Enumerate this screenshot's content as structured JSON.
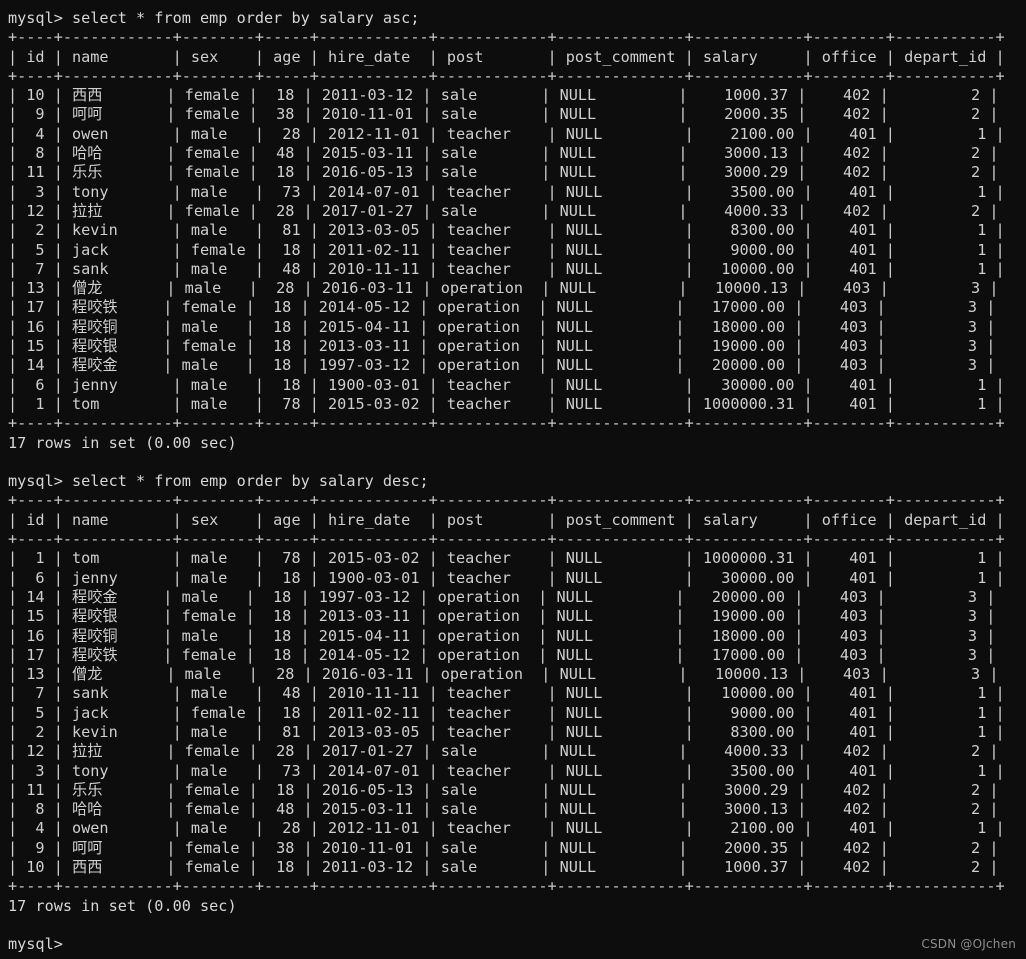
{
  "terminal": {
    "prompt": "mysql> ",
    "colors": {
      "background": "#0d0d0d",
      "foreground": "#cfcfcf",
      "watermark": "#8d8d8d"
    },
    "watermark": "CSDN @OJchen",
    "trailing_prompt": "mysql>"
  },
  "table_schema": {
    "columns": [
      {
        "name": "id",
        "width": 2,
        "align": "right"
      },
      {
        "name": "name",
        "width": 10,
        "align": "left"
      },
      {
        "name": "sex",
        "width": 6,
        "align": "left"
      },
      {
        "name": "age",
        "width": 3,
        "align": "right"
      },
      {
        "name": "hire_date",
        "width": 10,
        "align": "left"
      },
      {
        "name": "post",
        "width": 10,
        "align": "left"
      },
      {
        "name": "post_comment",
        "width": 12,
        "align": "left"
      },
      {
        "name": "salary",
        "width": 10,
        "align": "right"
      },
      {
        "name": "office",
        "width": 6,
        "align": "right"
      },
      {
        "name": "depart_id",
        "width": 9,
        "align": "right"
      }
    ]
  },
  "blocks": [
    {
      "command": "select * from emp order by salary asc;",
      "status": "17 rows in set (0.00 sec)",
      "rows": [
        [
          "10",
          "西西",
          "female",
          "18",
          "2011-03-12",
          "sale",
          "NULL",
          "1000.37",
          "402",
          "2"
        ],
        [
          "9",
          "呵呵",
          "female",
          "38",
          "2010-11-01",
          "sale",
          "NULL",
          "2000.35",
          "402",
          "2"
        ],
        [
          "4",
          "owen",
          "male",
          "28",
          "2012-11-01",
          "teacher",
          "NULL",
          "2100.00",
          "401",
          "1"
        ],
        [
          "8",
          "哈哈",
          "female",
          "48",
          "2015-03-11",
          "sale",
          "NULL",
          "3000.13",
          "402",
          "2"
        ],
        [
          "11",
          "乐乐",
          "female",
          "18",
          "2016-05-13",
          "sale",
          "NULL",
          "3000.29",
          "402",
          "2"
        ],
        [
          "3",
          "tony",
          "male",
          "73",
          "2014-07-01",
          "teacher",
          "NULL",
          "3500.00",
          "401",
          "1"
        ],
        [
          "12",
          "拉拉",
          "female",
          "28",
          "2017-01-27",
          "sale",
          "NULL",
          "4000.33",
          "402",
          "2"
        ],
        [
          "2",
          "kevin",
          "male",
          "81",
          "2013-03-05",
          "teacher",
          "NULL",
          "8300.00",
          "401",
          "1"
        ],
        [
          "5",
          "jack",
          "female",
          "18",
          "2011-02-11",
          "teacher",
          "NULL",
          "9000.00",
          "401",
          "1"
        ],
        [
          "7",
          "sank",
          "male",
          "48",
          "2010-11-11",
          "teacher",
          "NULL",
          "10000.00",
          "401",
          "1"
        ],
        [
          "13",
          "僧龙",
          "male",
          "28",
          "2016-03-11",
          "operation",
          "NULL",
          "10000.13",
          "403",
          "3"
        ],
        [
          "17",
          "程咬铁",
          "female",
          "18",
          "2014-05-12",
          "operation",
          "NULL",
          "17000.00",
          "403",
          "3"
        ],
        [
          "16",
          "程咬铜",
          "male",
          "18",
          "2015-04-11",
          "operation",
          "NULL",
          "18000.00",
          "403",
          "3"
        ],
        [
          "15",
          "程咬银",
          "female",
          "18",
          "2013-03-11",
          "operation",
          "NULL",
          "19000.00",
          "403",
          "3"
        ],
        [
          "14",
          "程咬金",
          "male",
          "18",
          "1997-03-12",
          "operation",
          "NULL",
          "20000.00",
          "403",
          "3"
        ],
        [
          "6",
          "jenny",
          "male",
          "18",
          "1900-03-01",
          "teacher",
          "NULL",
          "30000.00",
          "401",
          "1"
        ],
        [
          "1",
          "tom",
          "male",
          "78",
          "2015-03-02",
          "teacher",
          "NULL",
          "1000000.31",
          "401",
          "1"
        ]
      ]
    },
    {
      "command": "select * from emp order by salary desc;",
      "status": "17 rows in set (0.00 sec)",
      "rows": [
        [
          "1",
          "tom",
          "male",
          "78",
          "2015-03-02",
          "teacher",
          "NULL",
          "1000000.31",
          "401",
          "1"
        ],
        [
          "6",
          "jenny",
          "male",
          "18",
          "1900-03-01",
          "teacher",
          "NULL",
          "30000.00",
          "401",
          "1"
        ],
        [
          "14",
          "程咬金",
          "male",
          "18",
          "1997-03-12",
          "operation",
          "NULL",
          "20000.00",
          "403",
          "3"
        ],
        [
          "15",
          "程咬银",
          "female",
          "18",
          "2013-03-11",
          "operation",
          "NULL",
          "19000.00",
          "403",
          "3"
        ],
        [
          "16",
          "程咬铜",
          "male",
          "18",
          "2015-04-11",
          "operation",
          "NULL",
          "18000.00",
          "403",
          "3"
        ],
        [
          "17",
          "程咬铁",
          "female",
          "18",
          "2014-05-12",
          "operation",
          "NULL",
          "17000.00",
          "403",
          "3"
        ],
        [
          "13",
          "僧龙",
          "male",
          "28",
          "2016-03-11",
          "operation",
          "NULL",
          "10000.13",
          "403",
          "3"
        ],
        [
          "7",
          "sank",
          "male",
          "48",
          "2010-11-11",
          "teacher",
          "NULL",
          "10000.00",
          "401",
          "1"
        ],
        [
          "5",
          "jack",
          "female",
          "18",
          "2011-02-11",
          "teacher",
          "NULL",
          "9000.00",
          "401",
          "1"
        ],
        [
          "2",
          "kevin",
          "male",
          "81",
          "2013-03-05",
          "teacher",
          "NULL",
          "8300.00",
          "401",
          "1"
        ],
        [
          "12",
          "拉拉",
          "female",
          "28",
          "2017-01-27",
          "sale",
          "NULL",
          "4000.33",
          "402",
          "2"
        ],
        [
          "3",
          "tony",
          "male",
          "73",
          "2014-07-01",
          "teacher",
          "NULL",
          "3500.00",
          "401",
          "1"
        ],
        [
          "11",
          "乐乐",
          "female",
          "18",
          "2016-05-13",
          "sale",
          "NULL",
          "3000.29",
          "402",
          "2"
        ],
        [
          "8",
          "哈哈",
          "female",
          "48",
          "2015-03-11",
          "sale",
          "NULL",
          "3000.13",
          "402",
          "2"
        ],
        [
          "4",
          "owen",
          "male",
          "28",
          "2012-11-01",
          "teacher",
          "NULL",
          "2100.00",
          "401",
          "1"
        ],
        [
          "9",
          "呵呵",
          "female",
          "38",
          "2010-11-01",
          "sale",
          "NULL",
          "2000.35",
          "402",
          "2"
        ],
        [
          "10",
          "西西",
          "female",
          "18",
          "2011-03-12",
          "sale",
          "NULL",
          "1000.37",
          "402",
          "2"
        ]
      ]
    }
  ]
}
